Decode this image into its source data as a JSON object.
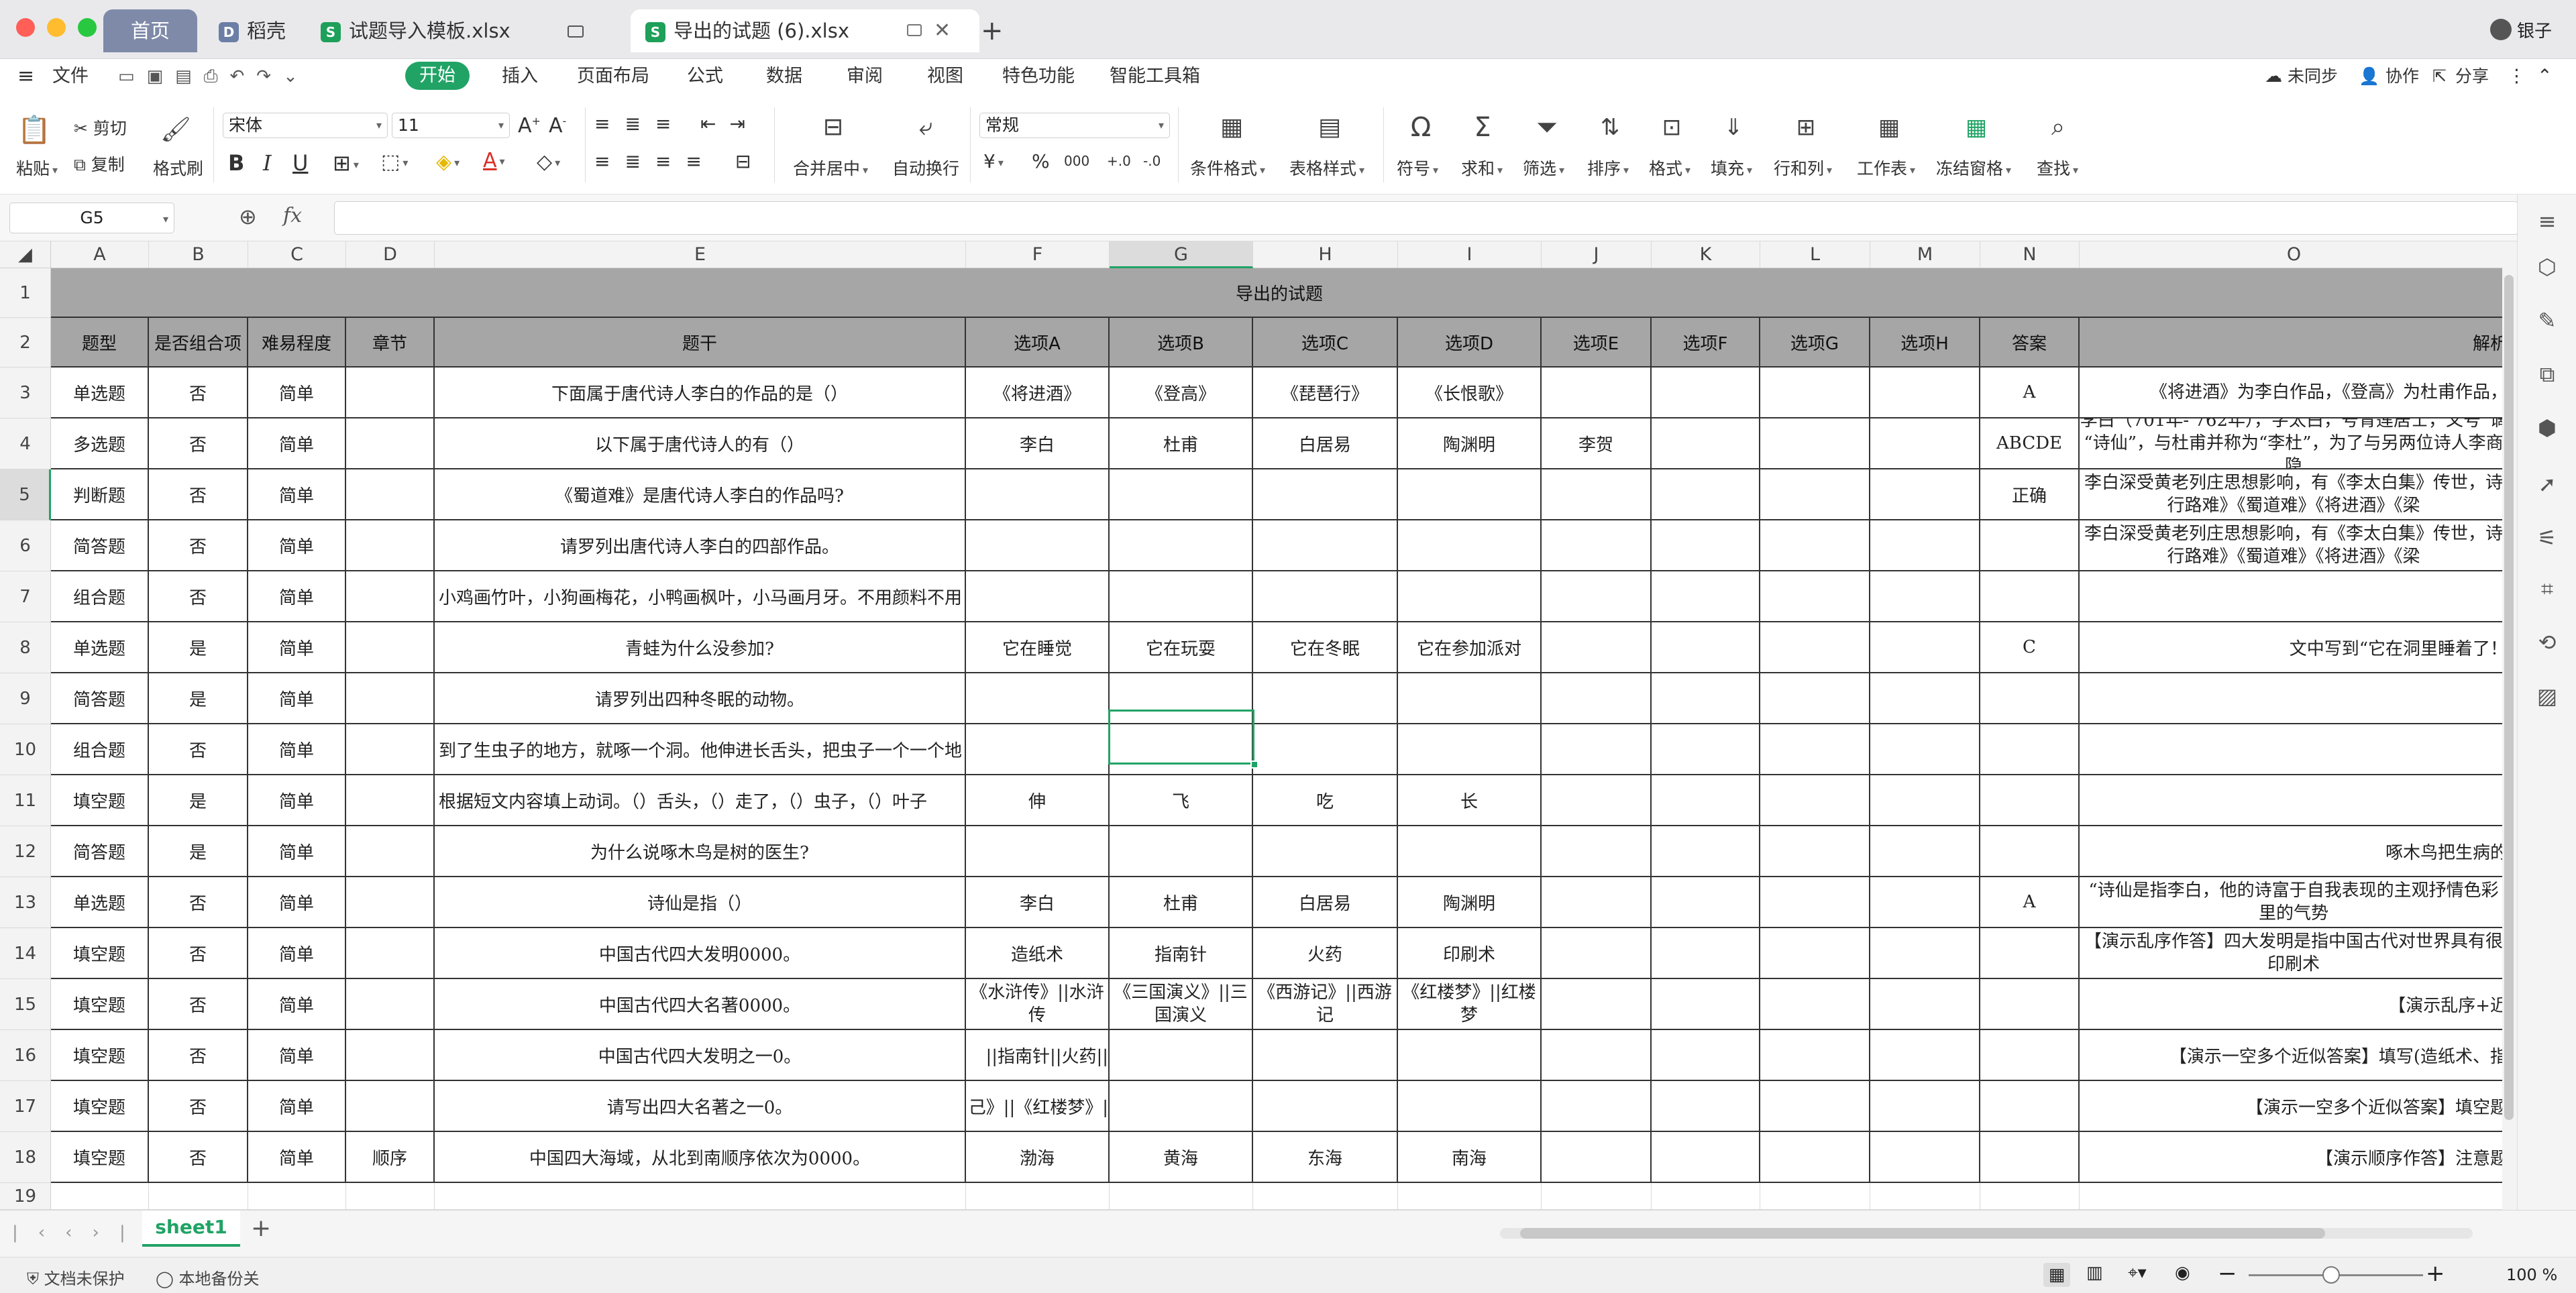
{
  "tabs": [
    {
      "label": "首页"
    },
    {
      "label": "稻壳"
    },
    {
      "label": "试题导入模板.xlsx"
    },
    {
      "label": ""
    },
    {
      "label": "导出的试题 (6).xlsx"
    }
  ],
  "user": {
    "name": "银子"
  },
  "menu": {
    "file": "文件",
    "items": [
      "开始",
      "插入",
      "页面布局",
      "公式",
      "数据",
      "审阅",
      "视图",
      "特色功能",
      "智能工具箱"
    ],
    "sync": "未同步",
    "collab": "协作",
    "share": "分享"
  },
  "ribbon": {
    "paste": "粘贴",
    "cut": "剪切",
    "copy": "复制",
    "format_painter": "格式刷",
    "font": "宋体",
    "size": "11",
    "merge": "合并居中",
    "wrap": "自动换行",
    "number_format": "常规",
    "cond_format": "条件格式",
    "table_style": "表格样式",
    "symbol": "符号",
    "sum": "求和",
    "filter": "筛选",
    "sort": "排序",
    "format": "格式",
    "fill": "填充",
    "row_col": "行和列",
    "worksheet": "工作表",
    "freeze": "冻结窗格",
    "find": "查找",
    "currency": "¥",
    "percent": "%",
    "thousand": "000",
    "inc_dec": "+.0",
    "dec_dec": "-.0"
  },
  "formula": {
    "name_box": "G5",
    "fx": "fx",
    "value": ""
  },
  "columns": [
    "A",
    "B",
    "C",
    "D",
    "E",
    "F",
    "G",
    "H",
    "I",
    "J",
    "K",
    "L",
    "M",
    "N",
    "O"
  ],
  "rows": [
    "1",
    "2",
    "3",
    "4",
    "5",
    "6",
    "7",
    "8",
    "9",
    "10",
    "11",
    "12",
    "13",
    "14",
    "15",
    "16",
    "17",
    "18",
    "19"
  ],
  "sheet": {
    "title": "导出的试题",
    "headers": [
      "题型",
      "是否组合项",
      "难易程度",
      "章节",
      "题干",
      "选项A",
      "选项B",
      "选项C",
      "选项D",
      "选项E",
      "选项F",
      "选项G",
      "选项H",
      "答案",
      "解析"
    ],
    "data": [
      [
        "单选题",
        "否",
        "简单",
        "",
        "下面属于唐代诗人李白的作品的是（）",
        "《将进酒》",
        "《登高》",
        "《琵琶行》",
        "《长恨歌》",
        "",
        "",
        "",
        "",
        "A",
        "《将进酒》为李白作品，《登高》为杜甫作品，"
      ],
      [
        "多选题",
        "否",
        "简单",
        "",
        "以下属于唐代诗人的有（）",
        "李白",
        "杜甫",
        "白居易",
        "陶渊明",
        "李贺",
        "",
        "",
        "",
        "ABCDE",
        "李白（701年- 762年），字太白，号青莲居士，又号“谪 “诗仙”，与杜甫并称为“李杜”，为了与另两位诗人李商隐"
      ],
      [
        "判断题",
        "否",
        "简单",
        "",
        "《蜀道难》是唐代诗人李白的作品吗?",
        "",
        "",
        "",
        "",
        "",
        "",
        "",
        "",
        "正确",
        "李白深受黄老列庄思想影响，有《李太白集》传世，诗 行路难》《蜀道难》《将进酒》《梁"
      ],
      [
        "简答题",
        "否",
        "简单",
        "",
        "请罗列出唐代诗人李白的四部作品。",
        "",
        "",
        "",
        "",
        "",
        "",
        "",
        "",
        "",
        "李白深受黄老列庄思想影响，有《李太白集》传世，诗 行路难》《蜀道难》《将进酒》《梁"
      ],
      [
        "组合题",
        "否",
        "简单",
        "",
        "小鸡画竹叶，小狗画梅花，小鸭画枫叶，小马画月牙。不用颜料不用",
        "",
        "",
        "",
        "",
        "",
        "",
        "",
        "",
        "",
        ""
      ],
      [
        "单选题",
        "是",
        "简单",
        "",
        "青蛙为什么没参加?",
        "它在睡觉",
        "它在玩耍",
        "它在冬眠",
        "它在参加派对",
        "",
        "",
        "",
        "",
        "C",
        "文中写到“它在洞里睡着了！"
      ],
      [
        "简答题",
        "是",
        "简单",
        "",
        "请罗列出四种冬眠的动物。",
        "",
        "",
        "",
        "",
        "",
        "",
        "",
        "",
        "",
        ""
      ],
      [
        "组合题",
        "否",
        "简单",
        "",
        "到了生虫子的地方，就啄一个洞。他伸进长舌头，把虫子一个一个地",
        "",
        "",
        "",
        "",
        "",
        "",
        "",
        "",
        "",
        ""
      ],
      [
        "填空题",
        "是",
        "简单",
        "",
        "根据短文内容填上动词。（）舌头，（）走了，（）虫子，（）叶子",
        "伸",
        "飞",
        "吃",
        "长",
        "",
        "",
        "",
        "",
        "",
        ""
      ],
      [
        "简答题",
        "是",
        "简单",
        "",
        "为什么说啄木鸟是树的医生?",
        "",
        "",
        "",
        "",
        "",
        "",
        "",
        "",
        "",
        "啄木鸟把生病的"
      ],
      [
        "单选题",
        "否",
        "简单",
        "",
        "诗仙是指（）",
        "李白",
        "杜甫",
        "白居易",
        "陶渊明",
        "",
        "",
        "",
        "",
        "A",
        "“诗仙是指李白，他的诗富于自我表现的主观抒情色彩 里的气势"
      ],
      [
        "填空题",
        "否",
        "简单",
        "",
        "中国古代四大发明0000。",
        "造纸术",
        "指南针",
        "火药",
        "印刷术",
        "",
        "",
        "",
        "",
        "",
        "【演示乱序作答】四大发明是指中国古代对世界具有很 印刷术"
      ],
      [
        "填空题",
        "否",
        "简单",
        "",
        "中国古代四大名著0000。",
        "《水浒传》||水浒传",
        "《三国演义》||三国演义",
        "《西游记》||西游记",
        "《红楼梦》||红楼梦",
        "",
        "",
        "",
        "",
        "",
        "【演示乱序+近"
      ],
      [
        "填空题",
        "否",
        "简单",
        "",
        "中国古代四大发明之一0。",
        "||指南针||火药||",
        "",
        "",
        "",
        "",
        "",
        "",
        "",
        "",
        "【演示一空多个近似答案】填写(造纸术、指"
      ],
      [
        "填空题",
        "否",
        "简单",
        "",
        "请写出四大名著之一0。",
        "己》||《红楼梦》|",
        "",
        "",
        "",
        "",
        "",
        "",
        "",
        "",
        "【演示一空多个近似答案】填空题"
      ],
      [
        "填空题",
        "否",
        "简单",
        "顺序",
        "中国四大海域，从北到南顺序依次为0000。",
        "渤海",
        "黄海",
        "东海",
        "南海",
        "",
        "",
        "",
        "",
        "",
        "【演示顺序作答】注意题"
      ]
    ]
  },
  "sheet_tabs": [
    "sheet1"
  ],
  "status": {
    "protect": "文档未保护",
    "backup": "本地备份关",
    "zoom": "100 %"
  }
}
